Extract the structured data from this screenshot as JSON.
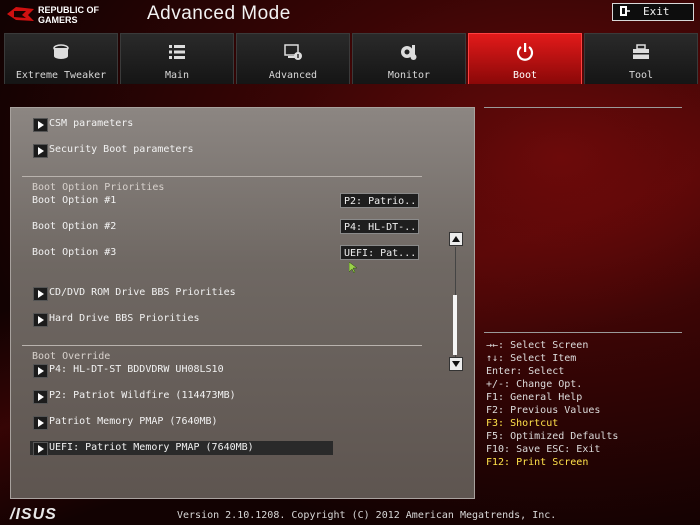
{
  "header": {
    "brand_line1": "REPUBLIC OF",
    "brand_line2": "GAMERS",
    "mode_title": "Advanced Mode",
    "exit_label": "Exit"
  },
  "tabs": [
    {
      "label": "Extreme Tweaker",
      "icon": "tweaker-icon"
    },
    {
      "label": "Main",
      "icon": "list-icon"
    },
    {
      "label": "Advanced",
      "icon": "advanced-icon"
    },
    {
      "label": "Monitor",
      "icon": "monitor-icon"
    },
    {
      "label": "Boot",
      "icon": "power-icon",
      "active": true
    },
    {
      "label": "Tool",
      "icon": "tool-icon"
    }
  ],
  "boot": {
    "submenus_top": [
      "CSM parameters",
      "Security Boot parameters"
    ],
    "priorities_header": "Boot Option Priorities",
    "options": [
      {
        "label": "Boot Option #1",
        "value": "P2: Patrio..."
      },
      {
        "label": "Boot Option #2",
        "value": "P4: HL-DT-..."
      },
      {
        "label": "Boot Option #3",
        "value": "UEFI:  Pat..."
      }
    ],
    "submenus_mid": [
      "CD/DVD ROM Drive BBS Priorities",
      "Hard Drive BBS Priorities"
    ],
    "override_header": "Boot Override",
    "overrides": [
      "P4: HL-DT-ST BDDVDRW UH08LS10",
      "P2: Patriot Wildfire  (114473MB)",
      " Patriot Memory PMAP  (7640MB)",
      "UEFI:  Patriot Memory PMAP (7640MB)"
    ]
  },
  "help": {
    "lines": [
      "→←: Select Screen",
      "↑↓: Select Item",
      "Enter: Select",
      "+/-: Change Opt.",
      "F1: General Help",
      "F2: Previous Values",
      "F3: Shortcut",
      "F5: Optimized Defaults",
      "F10: Save  ESC: Exit",
      "F12: Print Screen"
    ],
    "highlight_color": "#ffe24a"
  },
  "footer": {
    "brand": "/ISUS",
    "version": "Version 2.10.1208. Copyright (C) 2012 American Megatrends, Inc."
  },
  "colors": {
    "accent": "#e21a1a",
    "background": "#1a0505"
  }
}
